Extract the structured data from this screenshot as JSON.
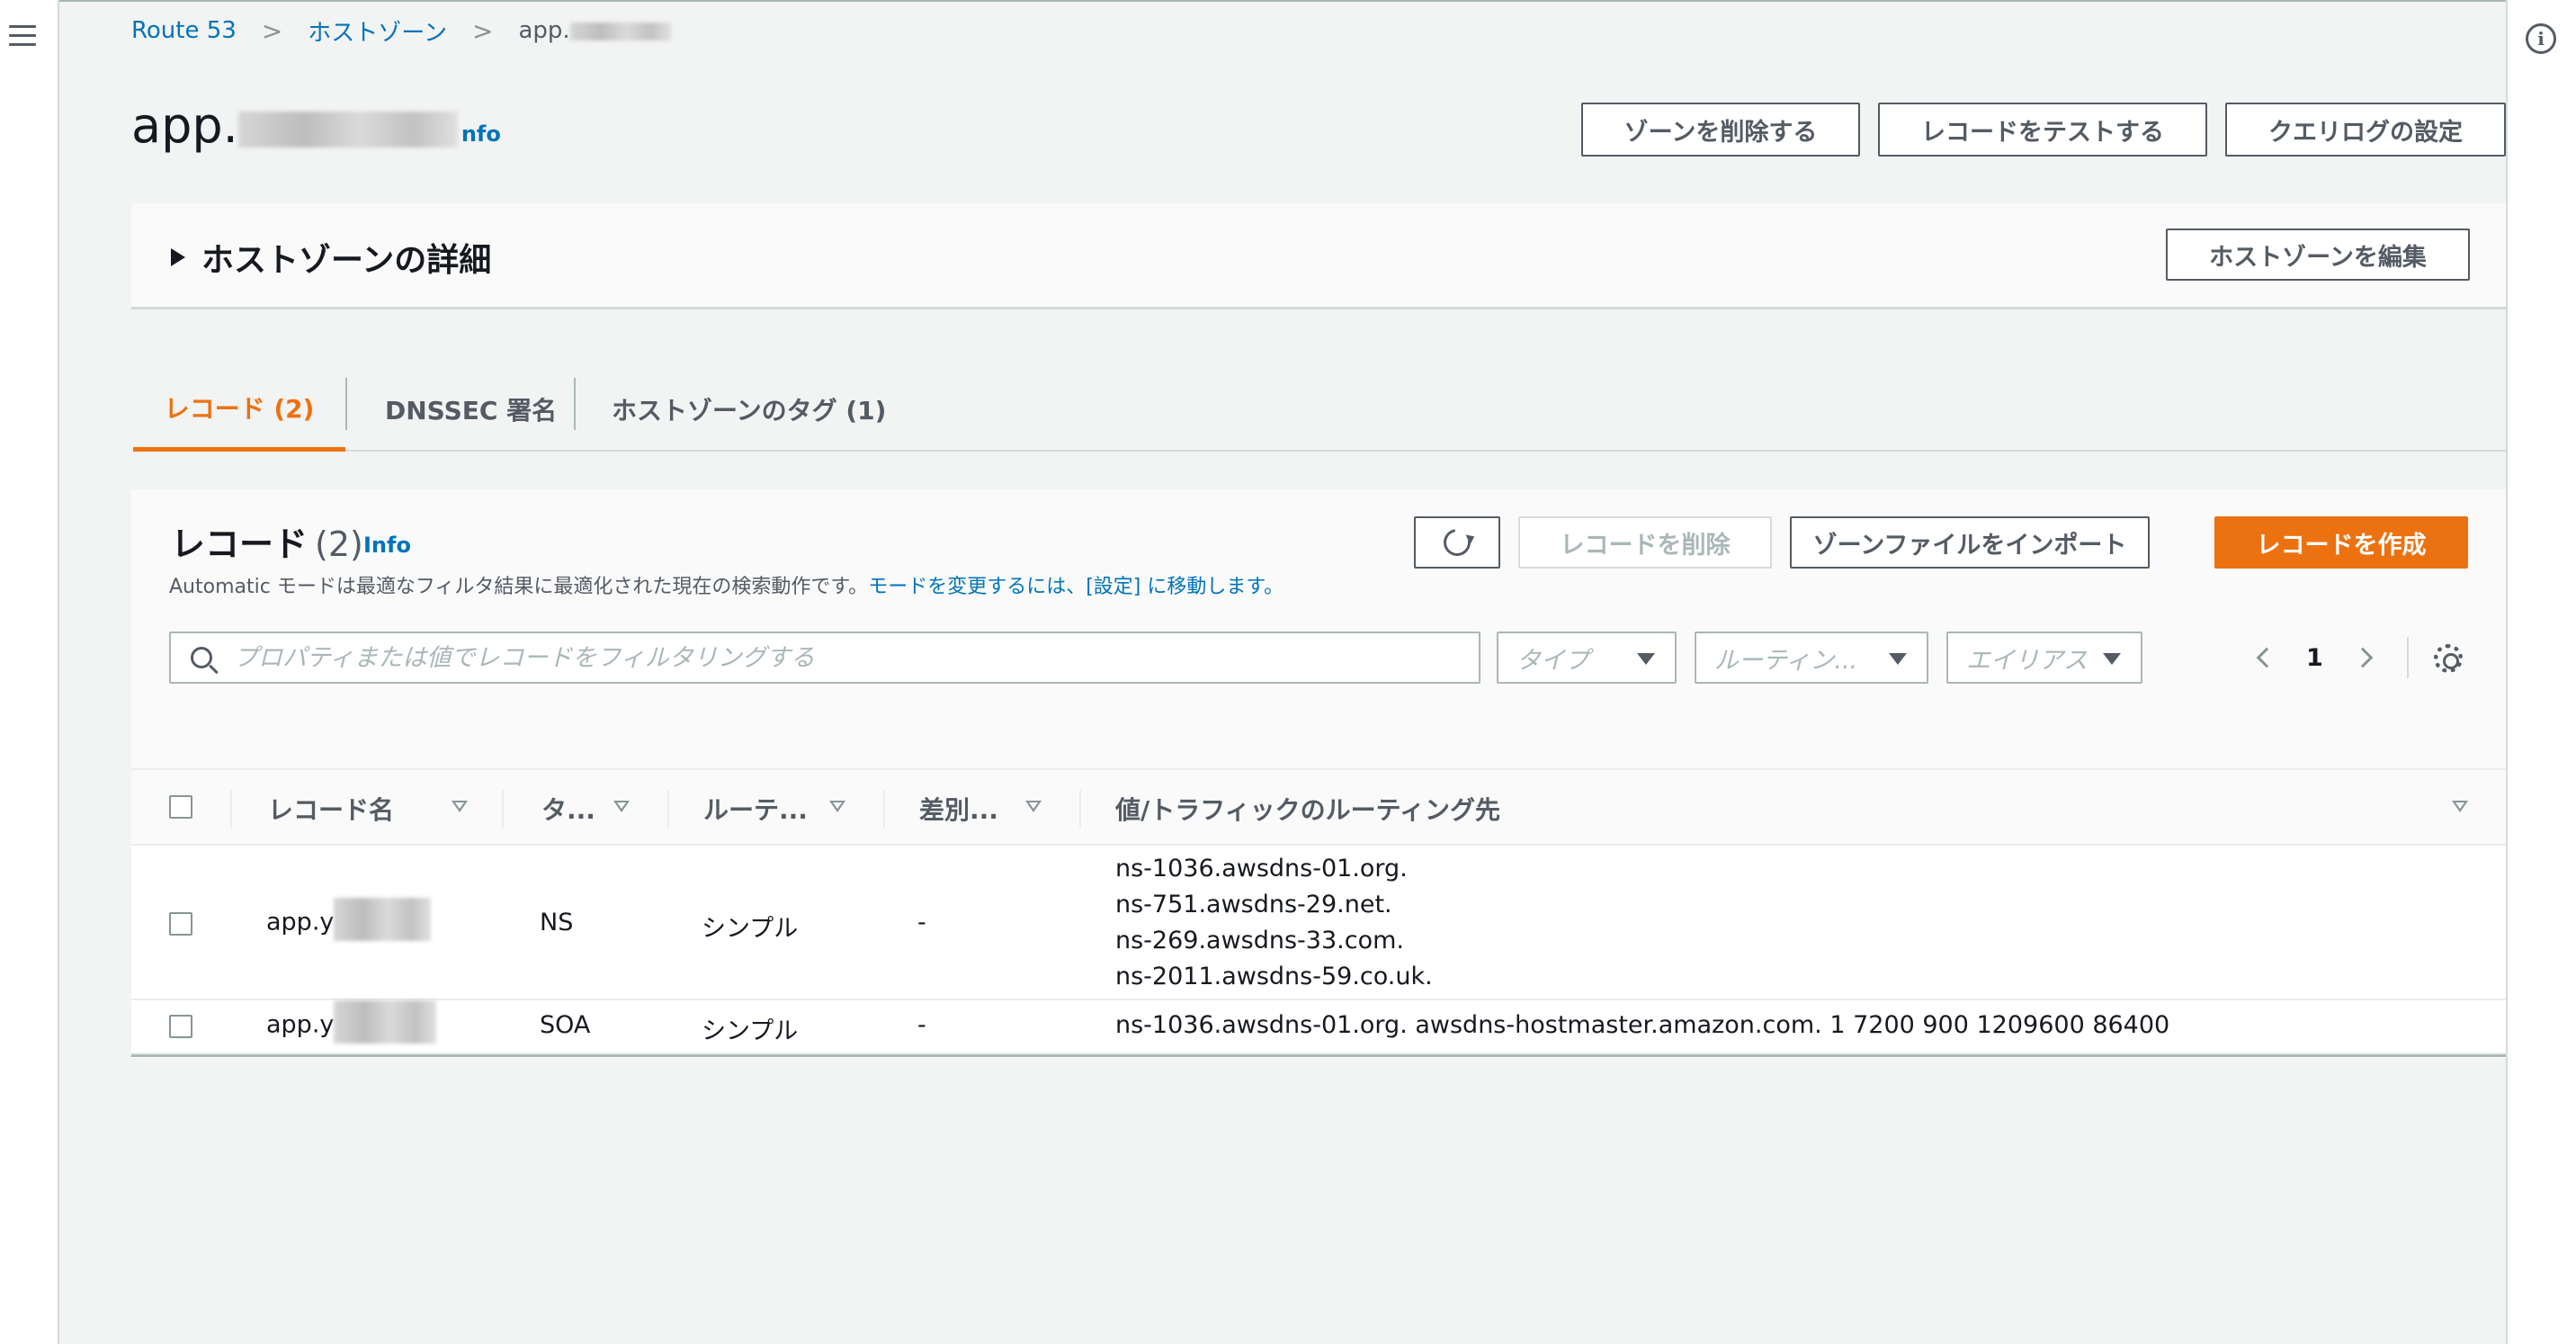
{
  "breadcrumb": {
    "root": "Route 53",
    "hosted_zones": "ホストゾーン",
    "current": "app."
  },
  "page": {
    "title": "app.",
    "info": "nfo"
  },
  "header_buttons": {
    "delete_zone": "ゾーンを削除する",
    "test_record": "レコードをテストする",
    "query_log": "クエリログの設定"
  },
  "details": {
    "title": "ホストゾーンの詳細",
    "edit_button": "ホストゾーンを編集"
  },
  "tabs": [
    {
      "label": "レコード (2)"
    },
    {
      "label": "DNSSEC 署名"
    },
    {
      "label": "ホストゾーンのタグ (1)"
    }
  ],
  "records": {
    "title": "レコード",
    "count": "(2)",
    "info": "Info",
    "description": "Automatic モードは最適なフィルタ結果に最適化された現在の検索動作です。",
    "description_link": "モードを変更するには、[設定] に移動します。",
    "delete_button": "レコードを削除",
    "import_button": "ゾーンファイルをインポート",
    "create_button": "レコードを作成",
    "search_placeholder": "プロパティまたは値でレコードをフィルタリングする",
    "filters": {
      "type": "タイプ",
      "routing": "ルーティン...",
      "alias": "エイリアス"
    },
    "page_number": "1",
    "columns": {
      "name": "レコード名",
      "type": "タ...",
      "routing": "ルーテ...",
      "differentiator": "差別...",
      "value": "値/トラフィックのルーティング先"
    },
    "rows": [
      {
        "name": "app.y",
        "type": "NS",
        "routing": "シンプル",
        "differentiator": "-",
        "values": [
          "ns-1036.awsdns-01.org.",
          "ns-751.awsdns-29.net.",
          "ns-269.awsdns-33.com.",
          "ns-2011.awsdns-59.co.uk."
        ]
      },
      {
        "name": "app.y",
        "type": "SOA",
        "routing": "シンプル",
        "differentiator": "-",
        "values": [
          "ns-1036.awsdns-01.org. awsdns-hostmaster.amazon.com. 1 7200 900 1209600 86400"
        ]
      }
    ]
  }
}
